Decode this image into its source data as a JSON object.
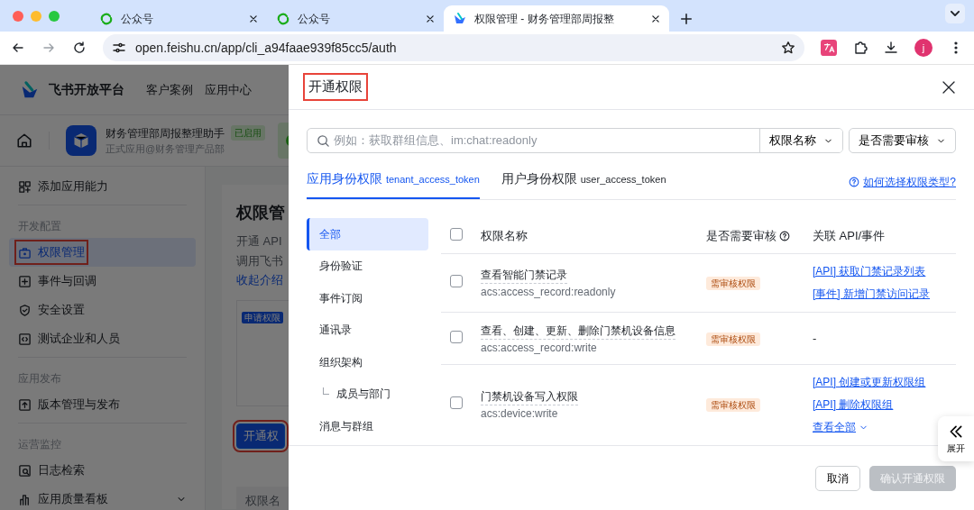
{
  "browser": {
    "tabs": [
      {
        "title": "公众号",
        "kind": "swirl",
        "selected": false
      },
      {
        "title": "公众号",
        "kind": "swirl",
        "selected": false
      },
      {
        "title": "权限管理 - 财务管理部周报整",
        "kind": "bird",
        "selected": true
      }
    ],
    "url": "open.feishu.cn/app/cli_a94faae939f85cc5/auth",
    "avatar": "j"
  },
  "page": {
    "logo": "飞书开放平台",
    "nav": [
      "客户案例",
      "应用中心"
    ],
    "app": {
      "name": "财务管理部周报整理助手",
      "status": "已启用",
      "subtitle": "正式应用@财务管理产品部"
    },
    "sidebar": [
      {
        "items": [
          {
            "label": "添加应用能力",
            "kind": "link",
            "selected": false,
            "highlighted": false
          }
        ]
      },
      {
        "heading": "开发配置",
        "items": [
          {
            "label": "权限管理",
            "kind": "link",
            "selected": true,
            "highlighted": true
          },
          {
            "label": "事件与回调",
            "kind": "link",
            "selected": false,
            "highlighted": false
          },
          {
            "label": "安全设置",
            "kind": "link",
            "selected": false,
            "highlighted": false
          },
          {
            "label": "测试企业和人员",
            "kind": "link",
            "selected": false,
            "highlighted": false
          }
        ]
      },
      {
        "heading": "应用发布",
        "items": [
          {
            "label": "版本管理与发布",
            "kind": "link",
            "selected": false,
            "highlighted": false
          }
        ]
      },
      {
        "heading": "运营监控",
        "items": [
          {
            "label": "日志检索",
            "kind": "link",
            "selected": false,
            "highlighted": false
          },
          {
            "label": "应用质量看板",
            "kind": "group",
            "selected": false,
            "highlighted": false
          }
        ]
      }
    ],
    "content": {
      "title": "权限管",
      "lines": [
        "开通 API",
        "调用飞书"
      ],
      "link": "收起介绍",
      "badge": "申请权限",
      "button": {
        "label": "开通权",
        "highlighted": true
      },
      "table_heading": "权限名"
    }
  },
  "drawer": {
    "title": "开通权限",
    "title_highlighted": true,
    "search": {
      "placeholder": "例如：获取群组信息、im:chat:readonly"
    },
    "filters": [
      "权限名称",
      "是否需要审核"
    ],
    "tabs": [
      {
        "label": "应用身份权限",
        "token": "tenant_access_token",
        "selected": true
      },
      {
        "label": "用户身份权限",
        "token": "user_access_token",
        "selected": false
      }
    ],
    "help": "如何选择权限类型?",
    "categories": [
      {
        "label": "全部",
        "selected": true
      },
      {
        "label": "身份验证",
        "selected": false
      },
      {
        "label": "事件订阅",
        "selected": false
      },
      {
        "label": "通讯录",
        "selected": false
      },
      {
        "label": "组织架构",
        "selected": false,
        "children": [
          {
            "label": "成员与部门",
            "selected": false
          }
        ]
      },
      {
        "label": "消息与群组",
        "selected": false
      }
    ],
    "columns": [
      "权限名称",
      "是否需要审核",
      "关联 API/事件"
    ],
    "all_checked": false,
    "rows": [
      {
        "name": "查看智能门禁记录",
        "scope": "acs:access_record:readonly",
        "review": "需审核权限",
        "links": [
          "[API] 获取门禁记录列表",
          "[事件] 新增门禁访问记录"
        ],
        "checked": false
      },
      {
        "name": "查看、创建、更新、删除门禁机设备信息",
        "scope": "acs:access_record:write",
        "review": "需审核权限",
        "empty": "-",
        "links": [],
        "checked": false
      },
      {
        "name": "门禁机设备写入权限",
        "scope": "acs:device:write",
        "review": "需审核权限",
        "links": [
          "[API] 创建或更新权限组",
          "[API] 删除权限组"
        ],
        "more": "查看全部",
        "checked": false
      }
    ],
    "side_button": "展开",
    "buttons": [
      {
        "label": "取消",
        "kind": "secondary",
        "disabled": false
      },
      {
        "label": "确认开通权限",
        "kind": "primary",
        "disabled": true
      }
    ]
  }
}
